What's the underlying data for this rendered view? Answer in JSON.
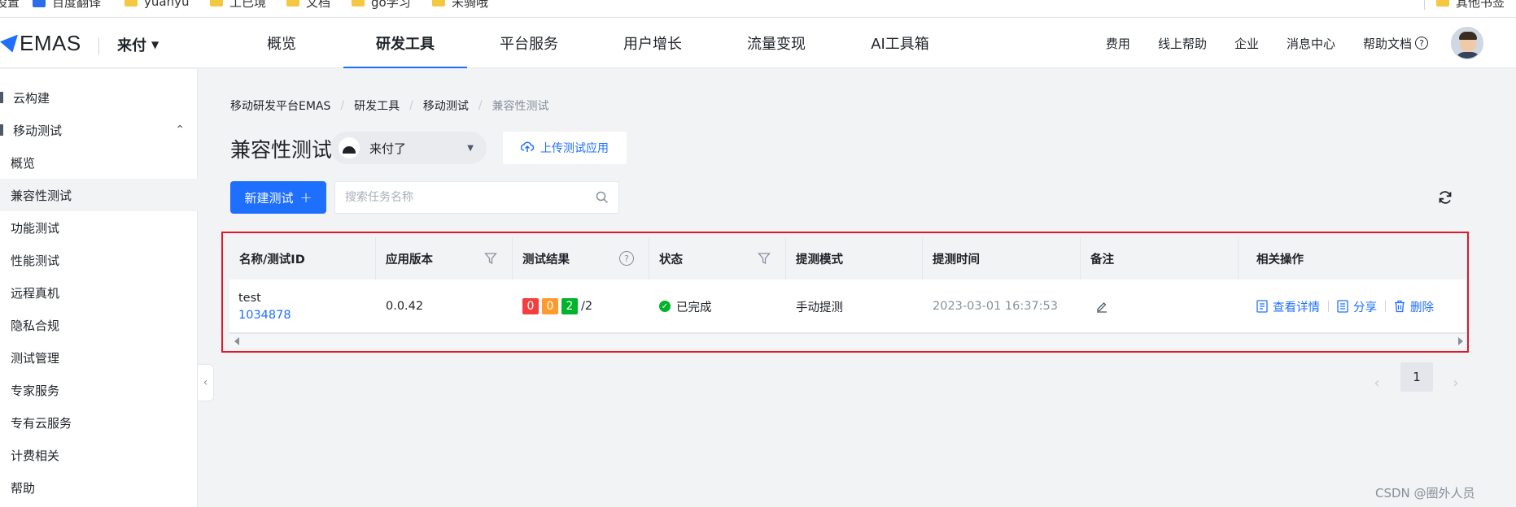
{
  "bookmarks": [
    {
      "label": "设置",
      "icon": "none"
    },
    {
      "label": "百度翻译",
      "icon": "app-icon"
    },
    {
      "label": "yuanyu",
      "icon": "folder-icon"
    },
    {
      "label": "工已境",
      "icon": "folder-icon"
    },
    {
      "label": "文档",
      "icon": "folder-icon"
    },
    {
      "label": "go学习",
      "icon": "folder-icon"
    },
    {
      "label": "未骑哦",
      "icon": "folder-icon"
    },
    {
      "label": "其他书签",
      "icon": "folder-icon"
    }
  ],
  "header": {
    "logo_text": "EMAS",
    "app_name": "来付",
    "tabs": [
      {
        "label": "概览",
        "active": false
      },
      {
        "label": "研发工具",
        "active": true
      },
      {
        "label": "平台服务",
        "active": false
      },
      {
        "label": "用户增长",
        "active": false
      },
      {
        "label": "流量变现",
        "active": false
      },
      {
        "label": "AI工具箱",
        "active": false
      }
    ],
    "right_links": [
      "费用",
      "线上帮助",
      "企业",
      "消息中心",
      "帮助文档"
    ]
  },
  "sidebar": {
    "items": [
      {
        "label": "云构建"
      },
      {
        "label": "移动测试"
      },
      {
        "label": "概览"
      },
      {
        "label": "兼容性测试"
      },
      {
        "label": "功能测试"
      },
      {
        "label": "性能测试"
      },
      {
        "label": "远程真机"
      },
      {
        "label": "隐私合规"
      },
      {
        "label": "测试管理"
      },
      {
        "label": "专家服务"
      },
      {
        "label": "专有云服务"
      },
      {
        "label": "计费相关"
      },
      {
        "label": "帮助"
      }
    ]
  },
  "breadcrumb": [
    "移动研发平台EMAS",
    "研发工具",
    "移动测试",
    "兼容性测试"
  ],
  "page": {
    "title": "兼容性测试",
    "app_select": "来付了",
    "upload_label": "上传测试应用",
    "new_test_label": "新建测试",
    "search_placeholder": "搜索任务名称"
  },
  "table": {
    "columns": [
      "名称/测试ID",
      "应用版本",
      "测试结果",
      "状态",
      "提测模式",
      "提测时间",
      "备注",
      "相关操作"
    ],
    "rows": [
      {
        "name": "test",
        "id": "1034878",
        "version": "0.0.42",
        "result": {
          "failed": "0",
          "warning": "0",
          "passed": "2",
          "total": "/2"
        },
        "status": "已完成",
        "mode": "手动提测",
        "time": "2023-03-01 16:37:53",
        "actions": [
          "查看详情",
          "分享",
          "删除"
        ]
      }
    ]
  },
  "pagination": {
    "current": "1"
  },
  "watermark": "CSDN @圈外人员",
  "colors": {
    "accent": "#1f6fff",
    "highlight_border": "#e0182a",
    "fail": "#f53f3f",
    "warn": "#ff9a2e",
    "pass": "#00b42a"
  }
}
